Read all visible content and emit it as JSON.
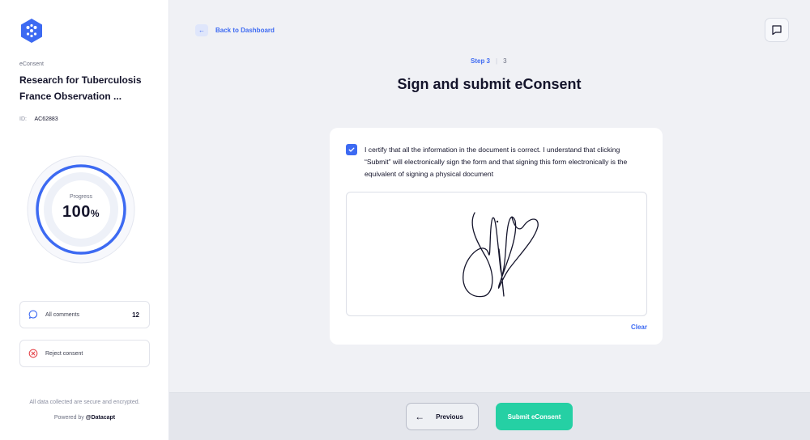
{
  "sidebar": {
    "section_label": "eConsent",
    "study_title": "Research for Tuberculosis France Observation ...",
    "id_label": "ID:",
    "id_value": "AC62883",
    "progress": {
      "label": "Progress",
      "value": "100",
      "unit": "%",
      "fraction": 1.0
    },
    "comments": {
      "label": "All comments",
      "count": "12"
    },
    "reject": {
      "label": "Reject consent"
    },
    "secure_note": "All data collected are secure and encrypted.",
    "powered_prefix": "Powered by ",
    "powered_brand": "@Datacapt"
  },
  "header": {
    "back_label": "Back to Dashboard",
    "chat_icon": "chat-icon"
  },
  "steps": {
    "current": "Step 3",
    "separator": "|",
    "total": "3"
  },
  "page_title": "Sign and submit eConsent",
  "consent": {
    "checked": true,
    "certify_text": "I certify that all the information in the document is correct. I understand that clicking “Submit” will electronically sign the form and that signing this form electronically is the equivalent of signing a physical document",
    "clear_label": "Clear"
  },
  "footer": {
    "previous_label": "Previous",
    "submit_label": "Submit eConsent"
  },
  "colors": {
    "accent": "#3d6af2",
    "submit": "#25d0a4",
    "reject_icon": "#e5484d"
  }
}
